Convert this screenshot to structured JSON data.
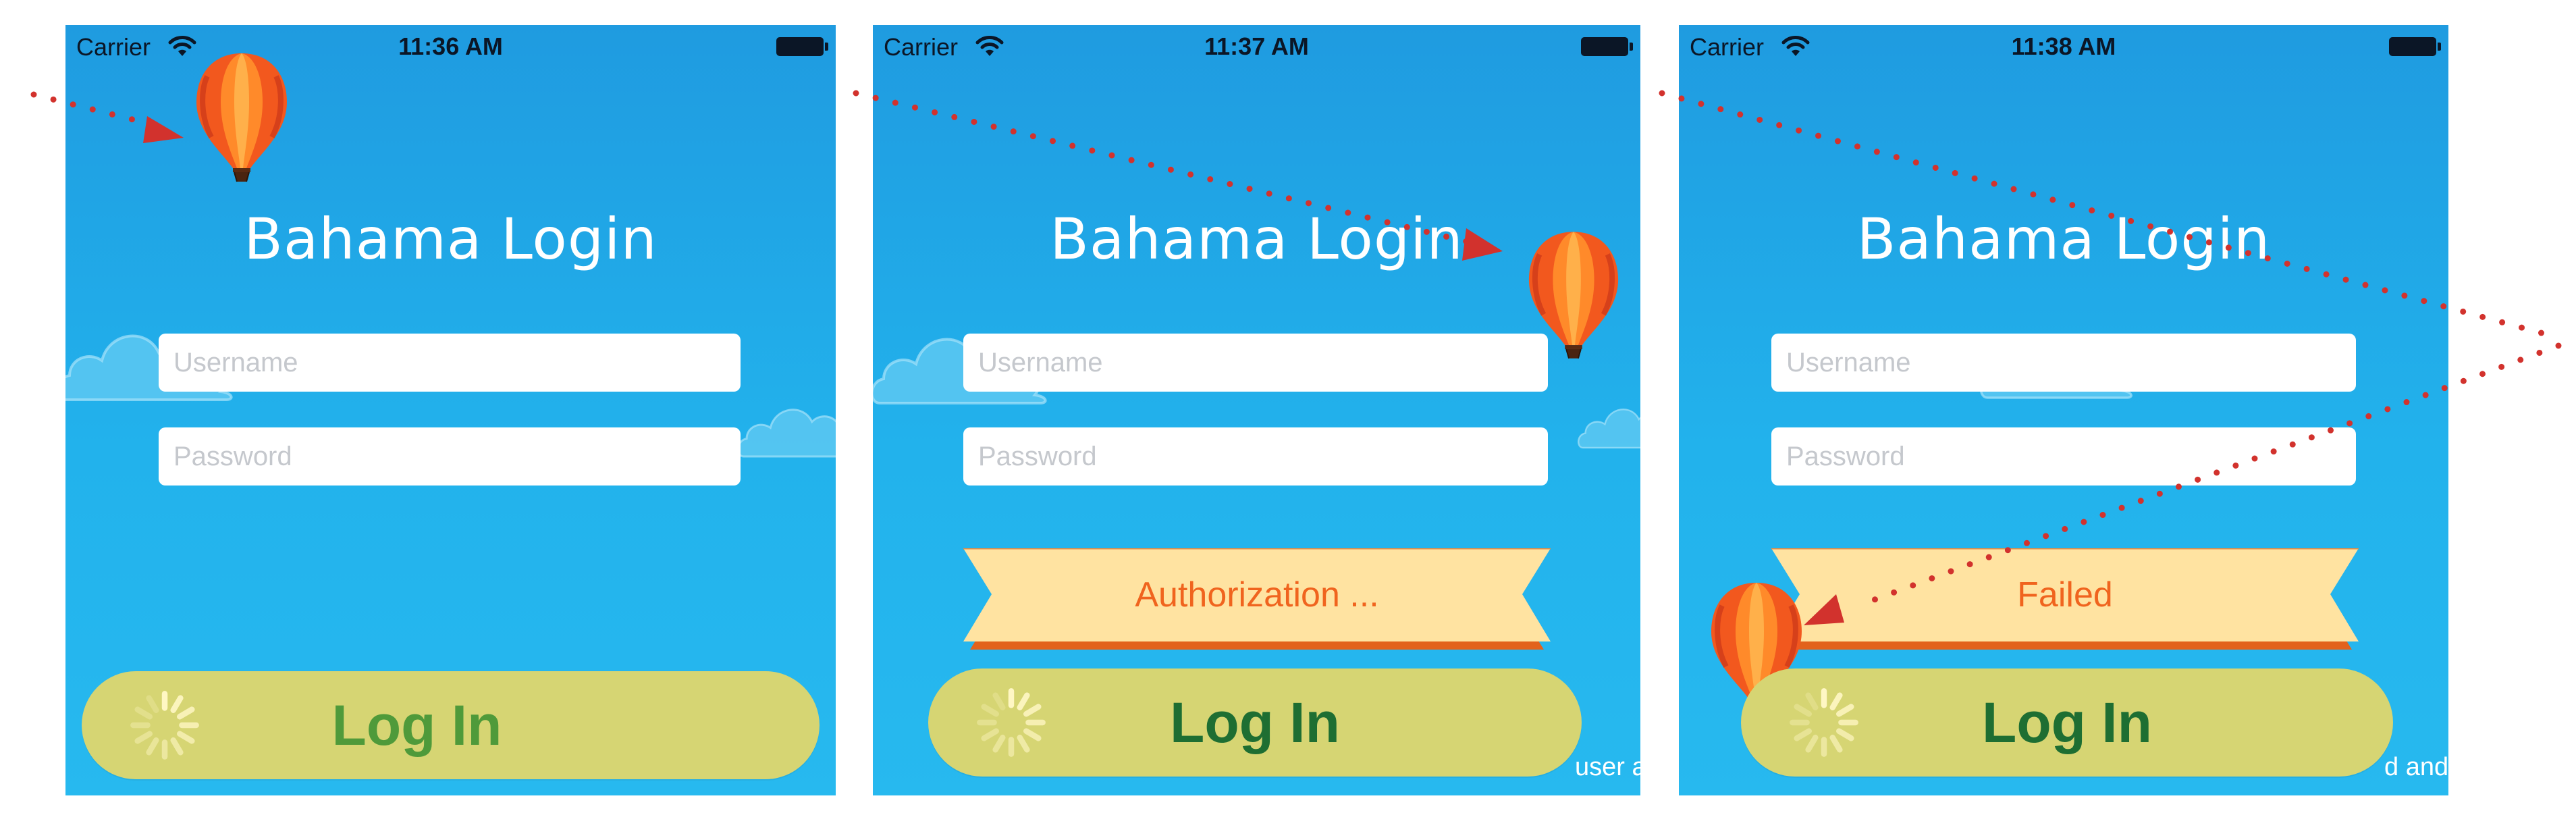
{
  "screens": [
    {
      "carrier": "Carrier",
      "time": "11:36 AM",
      "title": "Bahama Login",
      "username_placeholder": "Username",
      "password_placeholder": "Password",
      "login_label": "Log In"
    },
    {
      "carrier": "Carrier",
      "time": "11:37 AM",
      "title": "Bahama Login",
      "username_placeholder": "Username",
      "password_placeholder": "Password",
      "banner_text": "Authorization ...",
      "login_label": "Log In",
      "cut_text": "user a"
    },
    {
      "carrier": "Carrier",
      "time": "11:38 AM",
      "title": "Bahama Login",
      "username_placeholder": "Username",
      "password_placeholder": "Password",
      "banner_text": "Failed",
      "login_label": "Log In",
      "cut_text": "d and"
    }
  ],
  "icons": [
    "wifi-icon",
    "battery-icon",
    "spinner-icon",
    "balloon-icon",
    "cloud-icon",
    "arrow-icon"
  ],
  "colors": {
    "sky_top": "#1f9be0",
    "sky_bottom": "#27b9ef",
    "login_button": "#d6d573",
    "login_text": "#1e6e32",
    "banner_fill": "#ffe3a1",
    "banner_text": "#f0641e",
    "path_dots": "#d2322d"
  }
}
